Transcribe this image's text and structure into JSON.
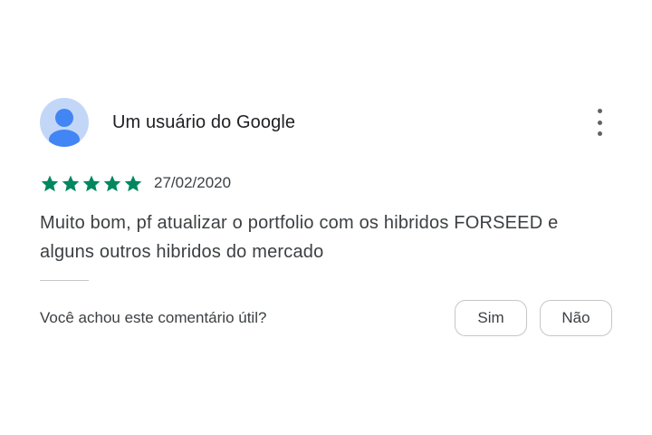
{
  "review": {
    "author": "Um usuário do Google",
    "avatar_icon": "person-avatar-icon",
    "menu_icon": "more-vert-icon",
    "rating": 5,
    "rating_max": 5,
    "date": "27/02/2020",
    "text": "Muito bom, pf atualizar o portfolio com os hibridos FORSEED e alguns outros hibridos do mercado"
  },
  "helpful": {
    "question": "Você achou este comentário útil?",
    "yes_label": "Sim",
    "no_label": "Não"
  },
  "colors": {
    "star": "#01875f",
    "avatar_bg": "#c2d7f8",
    "avatar_fg": "#4285f4",
    "border": "#c4c7c5"
  }
}
